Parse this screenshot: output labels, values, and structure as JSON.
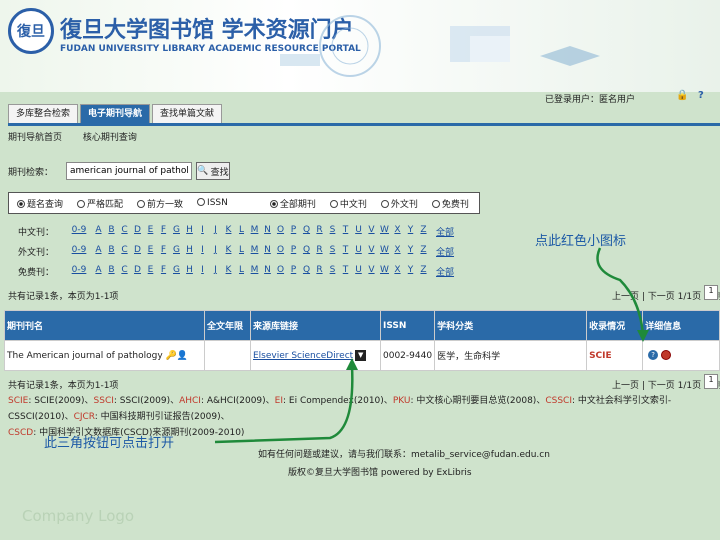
{
  "header": {
    "logo_text": "復旦",
    "title": "復旦大学图书馆 学术资源门户",
    "subtitle": "FUDAN UNIVERSITY LIBRARY ACADEMIC RESOURCE PORTAL"
  },
  "user": {
    "login_status": "已登录用户：匿名用户",
    "help": "?"
  },
  "tabs": [
    {
      "label": "多库整合检索"
    },
    {
      "label": "电子期刊导航"
    },
    {
      "label": "查找单篇文献"
    }
  ],
  "subnav": [
    "期刊导航首页",
    "核心期刊查询"
  ],
  "search": {
    "label": "期刊检索：",
    "value": "american journal of pathology",
    "button": "查找"
  },
  "options": {
    "match": [
      "题名查询",
      "严格匹配",
      "前方一致",
      "ISSN"
    ],
    "scope": [
      "全部期刊",
      "中文刊",
      "外文刊",
      "免费刊"
    ]
  },
  "letters": {
    "rows": [
      {
        "label": "中文刊："
      },
      {
        "label": "外文刊："
      },
      {
        "label": "免费刊："
      }
    ],
    "first": "0-9",
    "list": [
      "A",
      "B",
      "C",
      "D",
      "E",
      "F",
      "G",
      "H",
      "I",
      "J",
      "K",
      "L",
      "M",
      "N",
      "O",
      "P",
      "Q",
      "R",
      "S",
      "T",
      "U",
      "V",
      "W",
      "X",
      "Y",
      "Z"
    ],
    "all": "全部"
  },
  "annotations": {
    "red_icon": "点此红色小图标",
    "triangle": "此三角按钮可点击打开"
  },
  "results": {
    "count_text": "共有记录1条，本页为1-1项",
    "pager": "上一页 | 下一页 1/1页 转到",
    "page": "1"
  },
  "table": {
    "headers": [
      "期刊刊名",
      "全文年限",
      "来源库链接",
      "ISSN",
      "学科分类",
      "收录情况",
      "详细信息"
    ],
    "rows": [
      {
        "title": "The American journal of pathology",
        "years": "",
        "source": "Elsevier ScienceDirect",
        "issn": "0002-9440",
        "subject": "医学，生命科学",
        "indexed": "SCIE",
        "detail": "?"
      }
    ]
  },
  "notes": {
    "line1": [
      {
        "key": "SCIE",
        "text": ": SCIE(2009)、"
      },
      {
        "key": "SSCI",
        "text": ": SSCI(2009)、"
      },
      {
        "key": "AHCI",
        "text": ": A&HCI(2009)、"
      },
      {
        "key": "EI",
        "text": ": Ei Compendex(2010)、"
      },
      {
        "key": "PKU",
        "text": ": 中文核心期刊要目总览(2008)、"
      },
      {
        "key": "CSSCI",
        "text": ": 中文社会科学引文索引-CSSCI(2010)、"
      },
      {
        "key": "CJCR",
        "text": ": 中国科技期刊引证报告(2009)、"
      }
    ],
    "line2": [
      {
        "key": "CSCD",
        "text": ": 中国科学引文数据库(CSCD)来源期刊(2009-2010)"
      }
    ]
  },
  "footer": {
    "contact": "如有任何问题或建议，请与我们联系：metalib_service@fudan.edu.cn",
    "copyright": "版权©复旦大学图书馆 powered by ExLibris"
  },
  "watermark": "Company Logo",
  "colors": {
    "accent": "#2a6aa8",
    "annotation": "#1d5aa6",
    "arrow": "#1f8a3a",
    "highlight": "#c0392b"
  }
}
